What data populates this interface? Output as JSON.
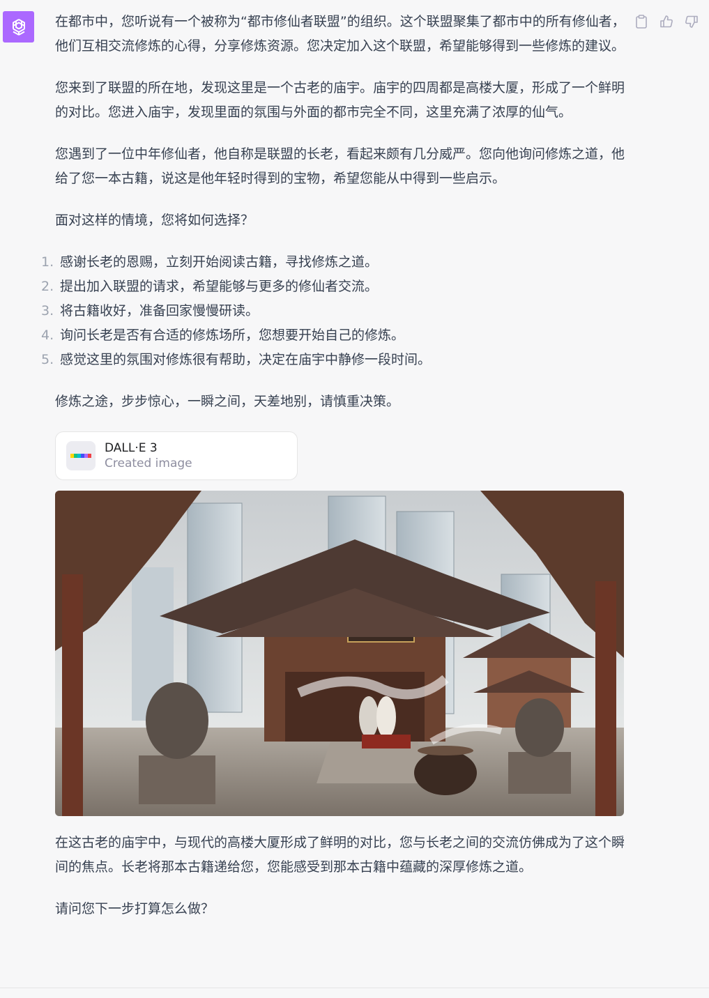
{
  "message": {
    "paragraphs_top": [
      "在都市中，您听说有一个被称为“都市修仙者联盟”的组织。这个联盟聚集了都市中的所有修仙者，他们互相交流修炼的心得，分享修炼资源。您决定加入这个联盟，希望能够得到一些修炼的建议。",
      "您来到了联盟的所在地，发现这里是一个古老的庙宇。庙宇的四周都是高楼大厦，形成了一个鲜明的对比。您进入庙宇，发现里面的氛围与外面的都市完全不同，这里充满了浓厚的仙气。",
      "您遇到了一位中年修仙者，他自称是联盟的长老，看起来颇有几分威严。您向他询问修炼之道，他给了您一本古籍，说这是他年轻时得到的宝物，希望您能从中得到一些启示。",
      "面对这样的情境，您将如何选择？"
    ],
    "choices": [
      {
        "num": "1.",
        "text": "感谢长老的恩赐，立刻开始阅读古籍，寻找修炼之道。"
      },
      {
        "num": "2.",
        "text": "提出加入联盟的请求，希望能够与更多的修仙者交流。"
      },
      {
        "num": "3.",
        "text": "将古籍收好，准备回家慢慢研读。"
      },
      {
        "num": "4.",
        "text": "询问长老是否有合适的修炼场所，您想要开始自己的修炼。"
      },
      {
        "num": "5.",
        "text": "感觉这里的氛围对修炼很有帮助，决定在庙宇中静修一段时间。"
      }
    ],
    "closing": "修炼之途，步步惊心，一瞬之间，天差地别，请慎重决策。",
    "paragraphs_bottom": [
      "在这古老的庙宇中，与现代的高楼大厦形成了鲜明的对比，您与长老之间的交流仿佛成为了这个瞬间的焦点。长老将那本古籍递给您，您能感受到那本古籍中蕴藏的深厚修炼之道。",
      "请问您下一步打算怎么做？"
    ]
  },
  "tool_card": {
    "name": "DALL·E 3",
    "status": "Created image"
  },
  "icons": {
    "avatar": "openai-logo-icon",
    "copy": "clipboard-icon",
    "like": "thumbs-up-icon",
    "dislike": "thumbs-down-icon"
  },
  "colors": {
    "avatar_bg": "#ab68ff",
    "page_bg": "#f7f7f8",
    "text": "#374151",
    "muted": "#9ca3af"
  }
}
